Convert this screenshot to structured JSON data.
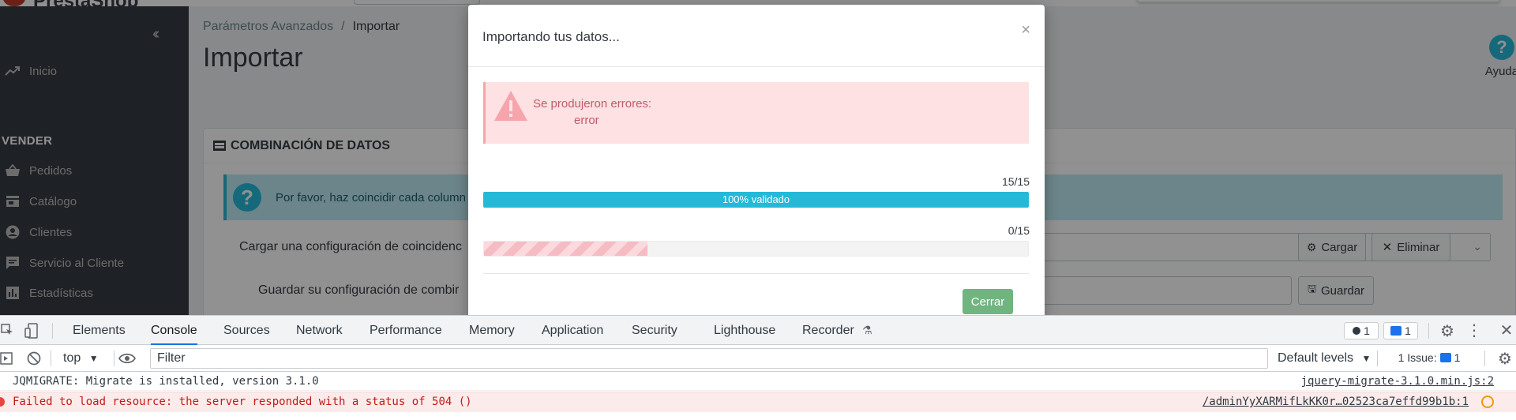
{
  "app": {
    "logo_text": "PrestaShop",
    "breadcrumb": {
      "parent": "Parámetros Avanzados",
      "current": "Importar"
    },
    "page_title": "Importar",
    "help_label": "Ayuda",
    "sidebar": {
      "inicio": "Inicio",
      "section": "VENDER",
      "items": [
        {
          "label": "Pedidos",
          "icon": "basket-icon"
        },
        {
          "label": "Catálogo",
          "icon": "store-icon"
        },
        {
          "label": "Clientes",
          "icon": "account-icon"
        },
        {
          "label": "Servicio al Cliente",
          "icon": "chat-icon"
        },
        {
          "label": "Estadísticas",
          "icon": "bar-chart-icon"
        }
      ]
    },
    "panel": {
      "title": "COMBINACIÓN DE DATOS",
      "info_text": "Por favor, haz coincidir cada column",
      "load_label": "Cargar una configuración de coincidenc",
      "save_label": "Guardar su configuración de combir",
      "load_button": "Cargar",
      "delete_button": "Eliminar",
      "save_button": "Guardar"
    }
  },
  "modal": {
    "title": "Importando tus datos...",
    "close_symbol": "×",
    "error_title": "Se produjeron errores:",
    "error_item": "error",
    "validated": {
      "count": "15/15",
      "label": "100% validado",
      "progress": 1.0
    },
    "imported": {
      "count": "0/15",
      "progress": 0.3
    },
    "close_button": "Cerrar"
  },
  "devtools": {
    "tabs": [
      "Elements",
      "Console",
      "Sources",
      "Network",
      "Performance",
      "Memory",
      "Application",
      "Security",
      "Lighthouse",
      "Recorder"
    ],
    "active_tab": "Console",
    "errors_badge": "1",
    "messages_badge": "1",
    "context": "top",
    "filter_placeholder": "Filter",
    "levels": "Default levels",
    "issues_label": "1 Issue:",
    "issues_count": "1",
    "logs": [
      {
        "level": "info",
        "message": "JQMIGRATE: Migrate is installed, version 3.1.0",
        "source": "jquery-migrate-3.1.0.min.js:2"
      },
      {
        "level": "error",
        "message": "Failed to load resource: the server responded with a status of 504 ()",
        "source": "/adminYyXARMifLkKK0r…02523ca7effd99b1b:1"
      }
    ]
  },
  "colors": {
    "accent": "#25b9d7",
    "sidebar_bg": "#363a41",
    "success": "#70b580",
    "error_bg": "#fde1e3",
    "error_text": "#c05c6a",
    "devtools_active": "#1a73e8"
  }
}
